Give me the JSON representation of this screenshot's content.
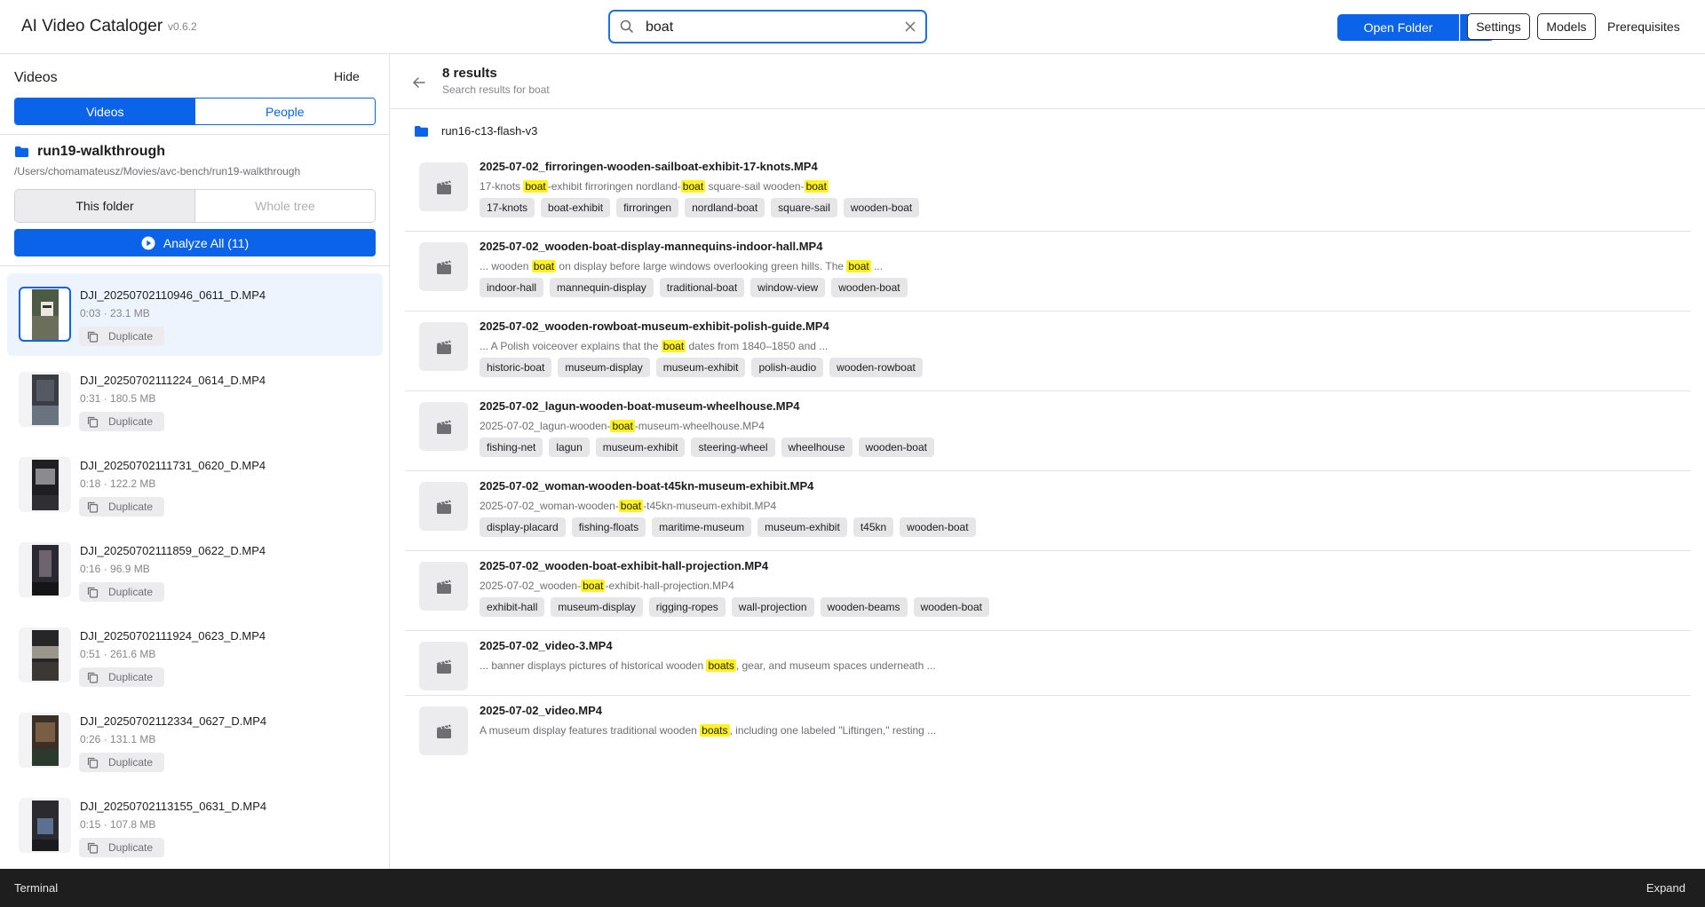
{
  "app": {
    "title": "AI Video Cataloger",
    "version": "v0.6.2"
  },
  "search": {
    "value": "boat",
    "placeholder": ""
  },
  "toolbar": {
    "open_folder": "Open Folder",
    "settings": "Settings",
    "models": "Models",
    "prerequisites": "Prerequisites"
  },
  "sidebar": {
    "title": "Videos",
    "hide": "Hide",
    "tabs": [
      "Videos",
      "People"
    ],
    "folder_name": "run19-walkthrough",
    "folder_path": "/Users/chomamateusz/Movies/avc-bench/run19-walkthrough",
    "scope": [
      "This folder",
      "Whole tree"
    ],
    "analyze": "Analyze All (11)",
    "duplicate_label": "Duplicate",
    "videos": [
      {
        "name": "DJI_20250702110946_0611_D.MP4",
        "meta": "0:03 · 23.1 MB",
        "selected": true
      },
      {
        "name": "DJI_20250702111224_0614_D.MP4",
        "meta": "0:31 · 180.5 MB"
      },
      {
        "name": "DJI_20250702111731_0620_D.MP4",
        "meta": "0:18 · 122.2 MB"
      },
      {
        "name": "DJI_20250702111859_0622_D.MP4",
        "meta": "0:16 · 96.9 MB"
      },
      {
        "name": "DJI_20250702111924_0623_D.MP4",
        "meta": "0:51 · 261.6 MB"
      },
      {
        "name": "DJI_20250702112334_0627_D.MP4",
        "meta": "0:26 · 131.1 MB"
      },
      {
        "name": "DJI_20250702113155_0631_D.MP4",
        "meta": "0:15 · 107.8 MB"
      }
    ]
  },
  "results": {
    "count": "8 results",
    "subtitle": "Search results for boat",
    "group": "run16-c13-flash-v3",
    "items": [
      {
        "name": "2025-07-02_firroringen-wooden-sailboat-exhibit-17-knots.MP4",
        "snippet": [
          "17-knots ",
          "boat",
          "-exhibit firroringen nordland-",
          "boat",
          " square-sail wooden-",
          "boat"
        ],
        "tags": [
          "17-knots",
          "boat-exhibit",
          "firroringen",
          "nordland-boat",
          "square-sail",
          "wooden-boat"
        ]
      },
      {
        "name": "2025-07-02_wooden-boat-display-mannequins-indoor-hall.MP4",
        "snippet": [
          "... wooden ",
          "boat",
          " on display before large windows overlooking green hills. The ",
          "boat",
          " ..."
        ],
        "tags": [
          "indoor-hall",
          "mannequin-display",
          "traditional-boat",
          "window-view",
          "wooden-boat"
        ]
      },
      {
        "name": "2025-07-02_wooden-rowboat-museum-exhibit-polish-guide.MP4",
        "snippet": [
          "... A Polish voiceover explains that the ",
          "boat",
          " dates from 1840–1850 and ..."
        ],
        "tags": [
          "historic-boat",
          "museum-display",
          "museum-exhibit",
          "polish-audio",
          "wooden-rowboat"
        ]
      },
      {
        "name": "2025-07-02_lagun-wooden-boat-museum-wheelhouse.MP4",
        "snippet": [
          "2025-07-02_lagun-wooden-",
          "boat",
          "-museum-wheelhouse.MP4"
        ],
        "tags": [
          "fishing-net",
          "lagun",
          "museum-exhibit",
          "steering-wheel",
          "wheelhouse",
          "wooden-boat"
        ]
      },
      {
        "name": "2025-07-02_woman-wooden-boat-t45kn-museum-exhibit.MP4",
        "snippet": [
          "2025-07-02_woman-wooden-",
          "boat",
          "-t45kn-museum-exhibit.MP4"
        ],
        "tags": [
          "display-placard",
          "fishing-floats",
          "maritime-museum",
          "museum-exhibit",
          "t45kn",
          "wooden-boat"
        ]
      },
      {
        "name": "2025-07-02_wooden-boat-exhibit-hall-projection.MP4",
        "snippet": [
          "2025-07-02_wooden-",
          "boat",
          "-exhibit-hall-projection.MP4"
        ],
        "tags": [
          "exhibit-hall",
          "museum-display",
          "rigging-ropes",
          "wall-projection",
          "wooden-beams",
          "wooden-boat"
        ]
      },
      {
        "name": "2025-07-02_video-3.MP4",
        "snippet": [
          "... banner displays pictures of historical wooden ",
          "boats",
          ", gear, and museum spaces underneath ..."
        ],
        "tags": []
      },
      {
        "name": "2025-07-02_video.MP4",
        "snippet": [
          "A museum display features traditional wooden ",
          "boats",
          ", including one labeled \"Liftingen,\" resting ..."
        ],
        "tags": []
      }
    ]
  },
  "terminal": {
    "label": "Terminal",
    "expand": "Expand"
  },
  "colors": {
    "accent": "#0a63e8",
    "highlight": "#fff21d",
    "terminal_bg": "#1e1e1e"
  },
  "icons": [
    "search-icon",
    "clear-icon",
    "chevron-down-icon",
    "folder-icon",
    "play-circle-icon",
    "copy-icon",
    "back-arrow-icon",
    "video-clapper-icon"
  ]
}
